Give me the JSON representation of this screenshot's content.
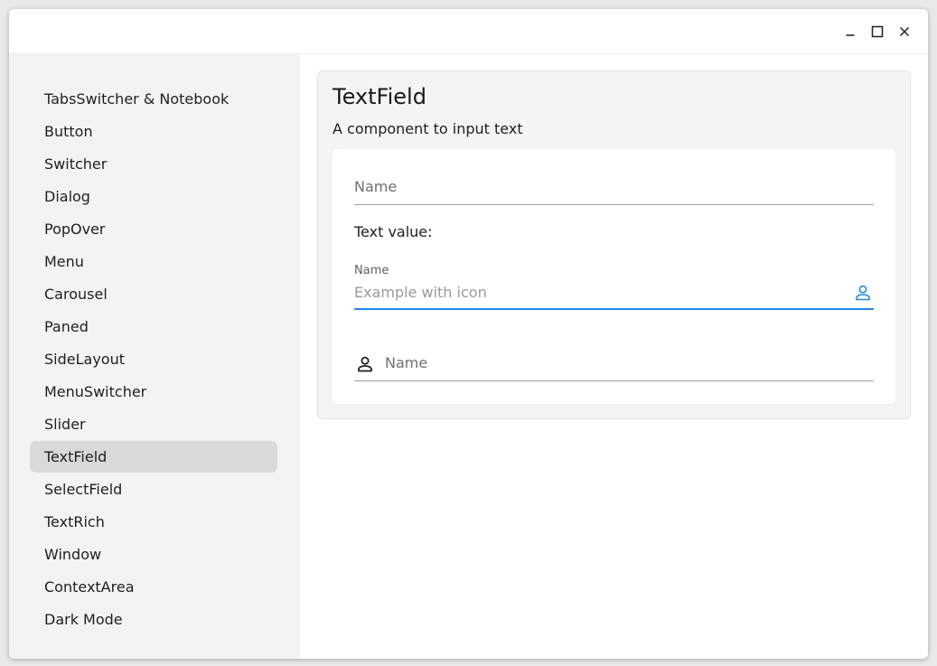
{
  "window": {
    "controls": {
      "minimize_icon": "minimize-icon",
      "maximize_icon": "maximize-icon",
      "close_icon": "close-icon"
    }
  },
  "sidebar": {
    "items": [
      {
        "label": "TabsSwitcher & Notebook"
      },
      {
        "label": "Button"
      },
      {
        "label": "Switcher"
      },
      {
        "label": "Dialog"
      },
      {
        "label": "PopOver"
      },
      {
        "label": "Menu"
      },
      {
        "label": "Carousel"
      },
      {
        "label": "Paned"
      },
      {
        "label": "SideLayout"
      },
      {
        "label": "MenuSwitcher"
      },
      {
        "label": "Slider"
      },
      {
        "label": "TextField"
      },
      {
        "label": "SelectField"
      },
      {
        "label": "TextRich"
      },
      {
        "label": "Window"
      },
      {
        "label": "ContextArea"
      },
      {
        "label": "Dark Mode"
      }
    ],
    "selected": "TextField"
  },
  "main": {
    "title": "TextField",
    "subtitle": "A component to input text",
    "fields": {
      "name_field": {
        "placeholder": "Name",
        "value": ""
      },
      "text_value_label": "Text value:",
      "icon_field": {
        "label": "Name",
        "placeholder": "Example with icon",
        "value": "",
        "icon": "person-icon",
        "focused": true
      },
      "leading_icon_field": {
        "placeholder": "Name",
        "value": "",
        "icon": "person-icon"
      }
    }
  },
  "colors": {
    "accent": "#1e88e5",
    "sidebar_bg": "#f3f3f3",
    "selected_item_bg": "#d9d9d9",
    "card_bg": "#f4f4f4"
  }
}
